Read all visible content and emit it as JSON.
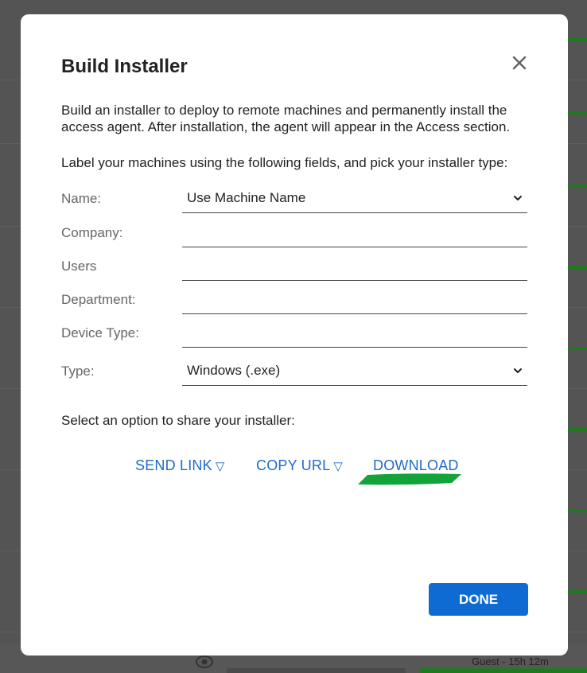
{
  "dialog": {
    "title": "Build Installer",
    "description": "Build an installer to deploy to remote machines and permanently install the access agent. After installation, the agent will appear in the Access section.",
    "instruction": "Label your machines using the following fields, and pick your installer type:",
    "fields": [
      {
        "label": "Name:",
        "value": "Use Machine Name",
        "kind": "select"
      },
      {
        "label": "Company:",
        "value": ""
      },
      {
        "label": "Users",
        "value": ""
      },
      {
        "label": "Department:",
        "value": ""
      },
      {
        "label": "Device Type:",
        "value": ""
      },
      {
        "label": "Type:",
        "value": "Windows (.exe)",
        "kind": "select"
      }
    ],
    "share_label": "Select an option to share your installer:",
    "share_options": {
      "send_link": "SEND LINK",
      "copy_url": "COPY URL",
      "download": "DOWNLOAD",
      "dropdown_glyph": "▽"
    },
    "done_label": "DONE",
    "colors": {
      "link": "#1e6bc9",
      "primary_button": "#0f6bd4",
      "highlight": "#12a33a"
    }
  },
  "background": {
    "status_text": "Guest - 15h 12m"
  }
}
